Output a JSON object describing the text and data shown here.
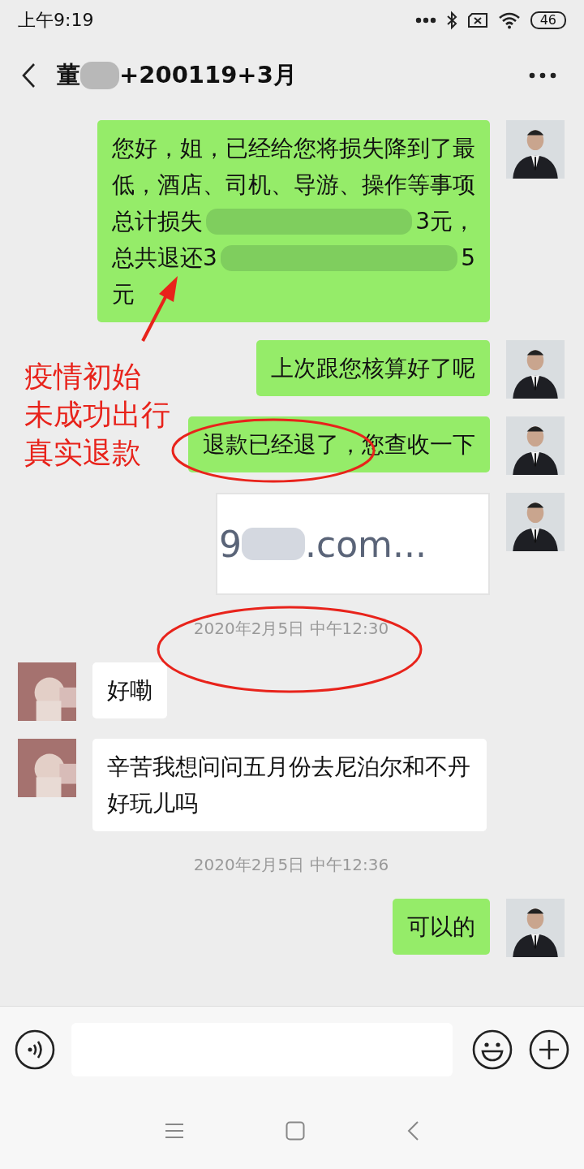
{
  "status_bar": {
    "time": "上午9:19",
    "battery": "46"
  },
  "header": {
    "title_parts": [
      {
        "kind": "text",
        "text": "董"
      },
      {
        "kind": "redacted"
      },
      {
        "kind": "text",
        "text": "+200119+3月"
      }
    ]
  },
  "messages": [
    {
      "kind": "text",
      "outgoing": true,
      "lines": [
        [
          {
            "kind": "text",
            "text": "您好，姐，已经给您将损失降到了最"
          }
        ],
        [
          {
            "kind": "text",
            "text": "低，酒店、司机、导游、操作等事项"
          }
        ],
        [
          {
            "kind": "text",
            "text": "总计损失"
          },
          {
            "kind": "redacted"
          },
          {
            "kind": "text",
            "text": "3元，"
          }
        ],
        [
          {
            "kind": "text",
            "text": "总共退还3"
          },
          {
            "kind": "redacted"
          },
          {
            "kind": "text",
            "text": "5"
          }
        ],
        [
          {
            "kind": "text",
            "text": "元"
          }
        ]
      ]
    },
    {
      "kind": "text",
      "outgoing": true,
      "lines": [
        [
          {
            "kind": "text",
            "text": "上次跟您核算好了呢"
          }
        ]
      ]
    },
    {
      "kind": "text",
      "outgoing": true,
      "lines": [
        [
          {
            "kind": "text",
            "text": "退款已经退了，您查收一下"
          }
        ]
      ]
    },
    {
      "kind": "image",
      "outgoing": true,
      "lines": [
        [
          {
            "kind": "text",
            "text": "9"
          },
          {
            "kind": "redacted"
          },
          {
            "kind": "text",
            "text": ".com..."
          }
        ]
      ]
    },
    {
      "kind": "time",
      "text": "2020年2月5日 中午12:30"
    },
    {
      "kind": "text",
      "outgoing": false,
      "lines": [
        [
          {
            "kind": "text",
            "text": "好嘞"
          }
        ]
      ]
    },
    {
      "kind": "text",
      "outgoing": false,
      "lines": [
        [
          {
            "kind": "text",
            "text": "辛苦我想问问五月份去尼泊尔和不丹好玩儿吗"
          }
        ]
      ]
    },
    {
      "kind": "time",
      "text": "2020年2月5日 中午12:36"
    },
    {
      "kind": "text",
      "outgoing": true,
      "lines": [
        [
          {
            "kind": "text",
            "text": "可以的"
          }
        ]
      ]
    }
  ],
  "annotation": {
    "lines": [
      "疫情初始",
      "未成功出行",
      "真实退款"
    ]
  }
}
